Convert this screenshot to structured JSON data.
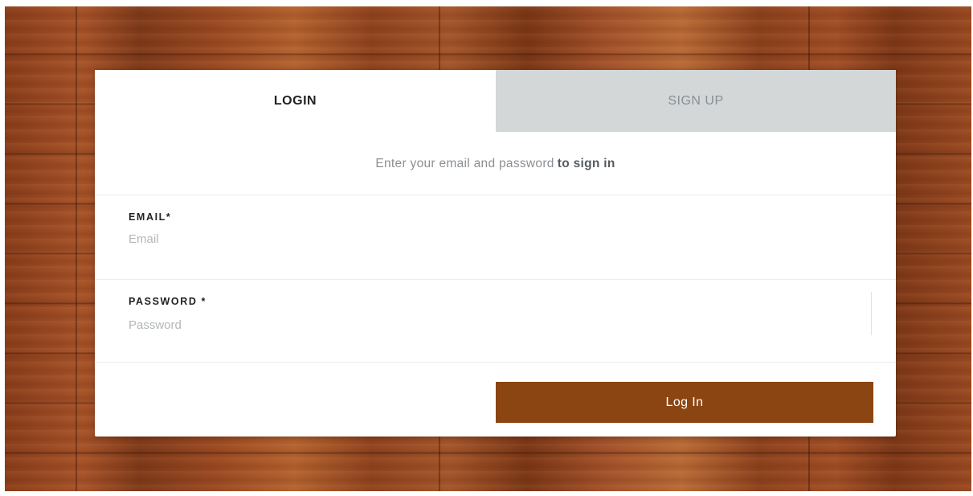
{
  "tabs": {
    "login": "LOGIN",
    "signup": "SIGN UP",
    "active": "login"
  },
  "subtitle": {
    "text": "Enter your email and password",
    "emphasis": "to sign in"
  },
  "form": {
    "email": {
      "label": "EMAIL*",
      "placeholder": "Email",
      "value": ""
    },
    "password": {
      "label": "PASSWORD *",
      "placeholder": "Password",
      "value": ""
    },
    "submit_label": "Log In"
  },
  "colors": {
    "button": "#8b4513",
    "inactive_tab": "#d3d7d8",
    "background": "wood-grain brown"
  }
}
